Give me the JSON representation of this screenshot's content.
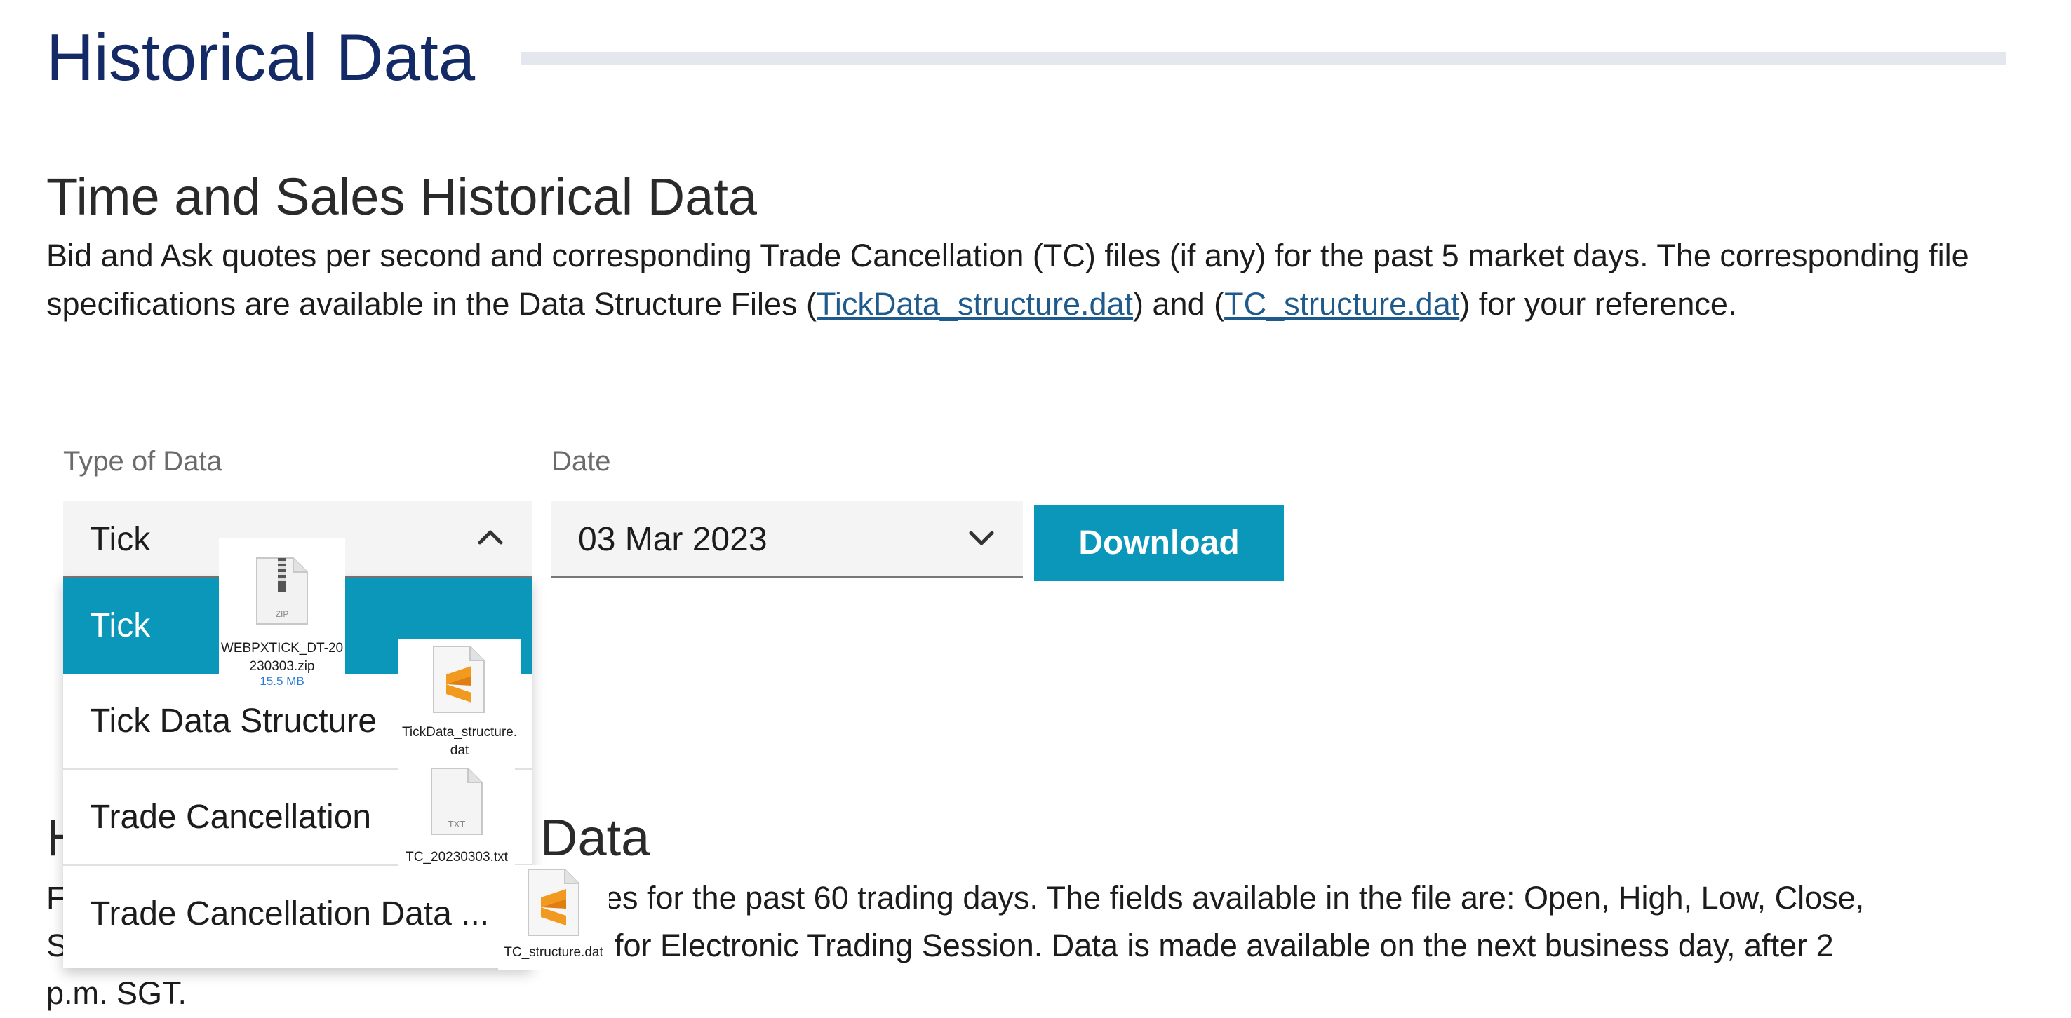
{
  "header": {
    "title": "Historical Data"
  },
  "tas_section": {
    "title": "Time and Sales Historical Data",
    "desc_part1": "Bid and Ask quotes per second and corresponding Trade Cancellation (TC) files (if any) for the past 5 market days.  The corresponding file specifications are available in the Data Structure Files (",
    "link1": "TickData_structure.dat",
    "desc_part2": ") and (",
    "link2": "TC_structure.dat",
    "desc_part3": ") for your reference."
  },
  "form": {
    "type_label": "Type of Data",
    "type_value": "Tick",
    "date_label": "Date",
    "date_value": "03 Mar 2023",
    "download_label": "Download"
  },
  "dropdown": {
    "options": [
      "Tick",
      "Tick Data Structure",
      "Trade Cancellation",
      "Trade Cancellation Data ..."
    ],
    "selected_index": 0
  },
  "second_section": {
    "title_visible_start": "H",
    "title_visible_end": "Data",
    "line1_start": "F",
    "line1_end": "es for the past 60 trading days. The fields available in the file are: Open, High, Low, Close,",
    "line2_start": "S",
    "line2_end": "for Electronic Trading Session. Data is made available on the next business day, after 2",
    "line3": "p.m. SGT."
  },
  "file_tiles": [
    {
      "name": "WEBPXTICK_DT-20230303.zip",
      "size": "15.5 MB",
      "icon": "zip-file-icon",
      "badge": "ZIP"
    },
    {
      "name": "TickData_structure.dat",
      "icon": "sublime-text-file-icon"
    },
    {
      "name": "TC_20230303.txt",
      "icon": "text-file-icon",
      "badge": "TXT"
    },
    {
      "name": "TC_structure.dat",
      "icon": "sublime-text-file-icon"
    }
  ],
  "colors": {
    "title": "#142a66",
    "accent": "#0a97b9",
    "link": "#1f5a8c",
    "sublime_orange": "#f29a1f"
  }
}
